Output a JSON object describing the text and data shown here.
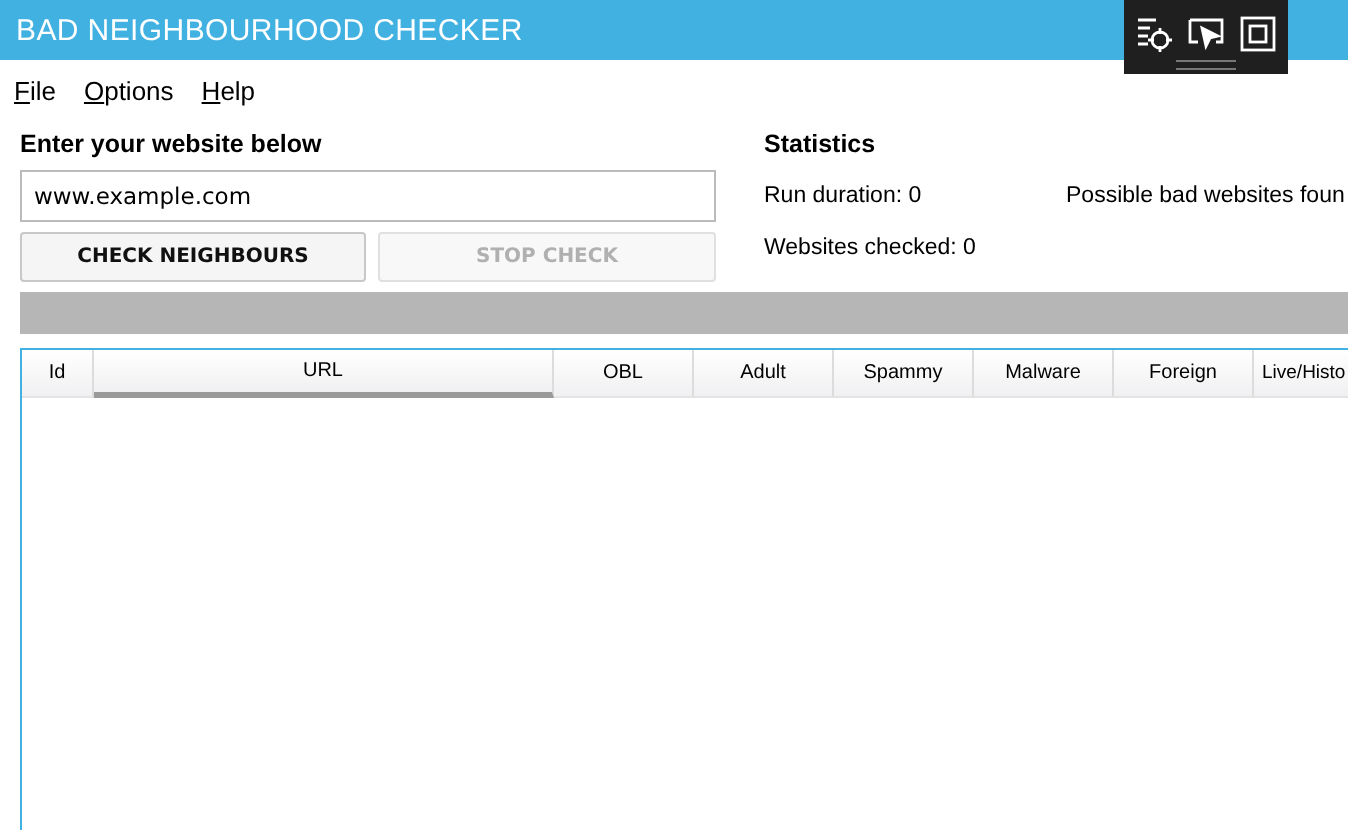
{
  "window": {
    "title": "BAD NEIGHBOURHOOD CHECKER"
  },
  "menu": [
    "File",
    "Options",
    "Help"
  ],
  "input_section": {
    "heading": "Enter your website below",
    "field": {
      "value": "www.example.com"
    },
    "buttons": [
      {
        "label": "CHECK NEIGHBOURS",
        "disabled": false
      },
      {
        "label": "STOP CHECK",
        "disabled": true
      }
    ]
  },
  "statistics": {
    "heading": "Statistics",
    "run_duration": "Run duration: 0",
    "bad_found": "Possible bad websites foun",
    "websites_checked": "Websites checked: 0"
  },
  "progress": {
    "level": 0
  },
  "table": {
    "columns": [
      {
        "label": "Id",
        "selected": false
      },
      {
        "label": "URL",
        "selected": true
      },
      {
        "label": "OBL",
        "selected": false
      },
      {
        "label": "Adult",
        "selected": false
      },
      {
        "label": "Spammy",
        "selected": false
      },
      {
        "label": "Malware",
        "selected": false
      },
      {
        "label": "Foreign",
        "selected": false
      },
      {
        "label": "Live/Histo",
        "selected": false
      }
    ]
  }
}
